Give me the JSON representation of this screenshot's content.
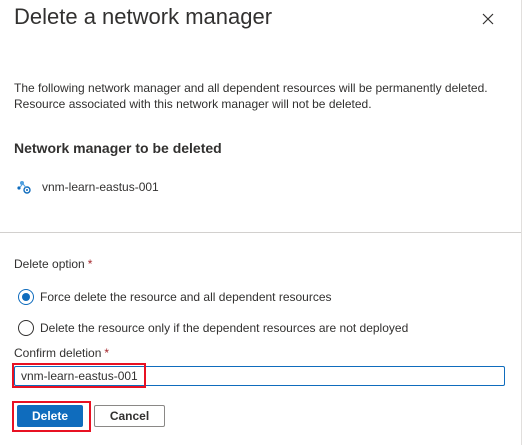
{
  "dialog": {
    "title": "Delete a network manager",
    "description_line1": "The following network manager and all dependent resources will be permanently deleted.",
    "description_line2": "Resource associated with this network manager will not be deleted.",
    "section_heading": "Network manager to be deleted",
    "resource": {
      "name": "vnm-learn-eastus-001",
      "icon": "network-manager-icon"
    },
    "delete_option": {
      "label": "Delete option",
      "required_marker": "*",
      "options": [
        {
          "label": "Force delete the resource and all dependent resources",
          "selected": true
        },
        {
          "label": "Delete the resource only if the dependent resources are not deployed",
          "selected": false
        }
      ]
    },
    "confirm": {
      "label": "Confirm deletion",
      "required_marker": "*",
      "value": "vnm-learn-eastus-001"
    },
    "buttons": {
      "delete": "Delete",
      "cancel": "Cancel"
    },
    "close_icon": "close-icon"
  },
  "colors": {
    "accent": "#0f6cbd",
    "highlight": "#e81123",
    "required": "#a4262c",
    "text": "#323130"
  }
}
